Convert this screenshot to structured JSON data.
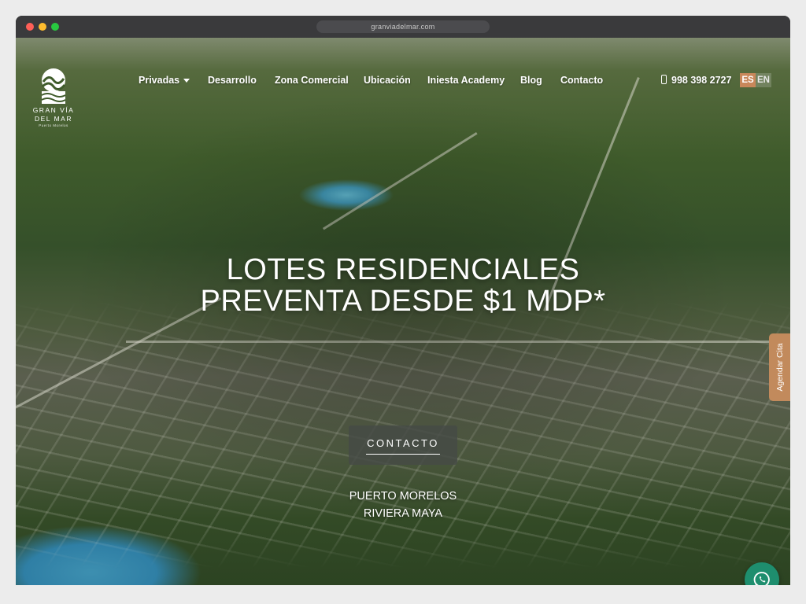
{
  "browser": {
    "url": "granviadelmar.com"
  },
  "logo": {
    "name_line1": "GRAN VÍA",
    "name_line2": "DEL MAR",
    "subtitle": "Puerto Morelos"
  },
  "nav": {
    "items": [
      {
        "label": "Privadas",
        "has_dropdown": true
      },
      {
        "label": "Desarrollo"
      },
      {
        "label": "Zona Comercial"
      },
      {
        "label": "Ubicación"
      },
      {
        "label": "Iniesta Academy"
      },
      {
        "label": "Blog"
      },
      {
        "label": "Contacto"
      }
    ],
    "phone": "998 398 2727",
    "phone_icon": "mobile-phone-icon",
    "languages": [
      {
        "label": "ES",
        "active": true
      },
      {
        "label": "EN",
        "active": false
      }
    ]
  },
  "hero": {
    "headline_line1": "LOTES RESIDENCIALES",
    "headline_line2": "PREVENTA DESDE $1 MDP*",
    "cta_label": "CONTACTO",
    "location_line1": "PUERTO MORELOS",
    "location_line2": "RIVIERA MAYA"
  },
  "side_tab": {
    "label": "Agendar Cita"
  },
  "whatsapp": {
    "icon": "whatsapp-icon"
  },
  "colors": {
    "accent": "#c28a5c",
    "whatsapp": "#1e8e6e",
    "cta_bg": "#464a46"
  }
}
